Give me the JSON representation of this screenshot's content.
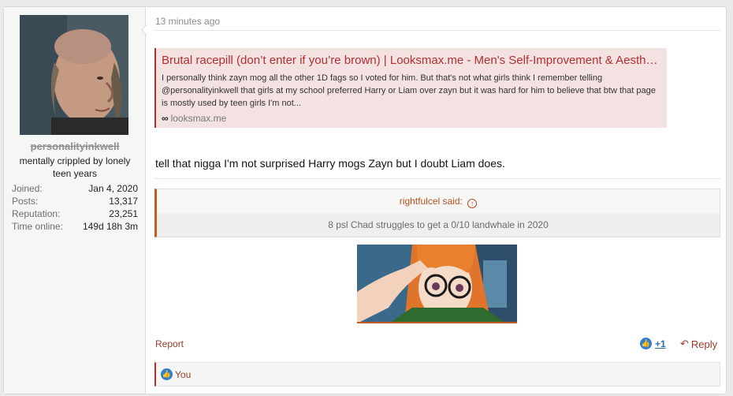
{
  "user": {
    "name": "personalityinkwell",
    "title": "mentally crippled by lonely teen years",
    "stats": [
      {
        "key": "Joined:",
        "value": "Jan 4, 2020"
      },
      {
        "key": "Posts:",
        "value": "13,317"
      },
      {
        "key": "Reputation:",
        "value": "23,251"
      },
      {
        "key": "Time online:",
        "value": "149d 18h 3m"
      }
    ]
  },
  "post": {
    "time": "13 minutes ago",
    "unfurl": {
      "title": "Brutal racepill (don’t enter if you’re brown) | Looksmax.me - Men's Self-Improvement & Aesthetics",
      "description": "I personally think zayn mog all the other 1D fags so I voted for him. But that's not what girls think I remember telling @personalityinkwell that girls at my school preferred Harry or Liam over zayn but it was hard for him to believe that btw that page is mostly used by teen girls I'm not...",
      "domain": "looksmax.me",
      "chain_glyph": "∞"
    },
    "message": "tell that nigga I'm not surprised Harry mogs Zayn but I doubt Liam does.",
    "quote": {
      "author": "rightfulcel said:",
      "up_glyph": "↑",
      "text": "8 psl Chad struggles to get a 0/10 landwhale in 2020"
    }
  },
  "footer": {
    "report_label": "Report",
    "reaction_count": "+1",
    "like_glyph": "👍",
    "reply_glyph": "↶",
    "reply_label": "Reply",
    "reactions_label": "You"
  },
  "colors": {
    "accent": "#b32f2f",
    "quote_accent": "#c75a20",
    "like_blue": "#2f80d1"
  }
}
